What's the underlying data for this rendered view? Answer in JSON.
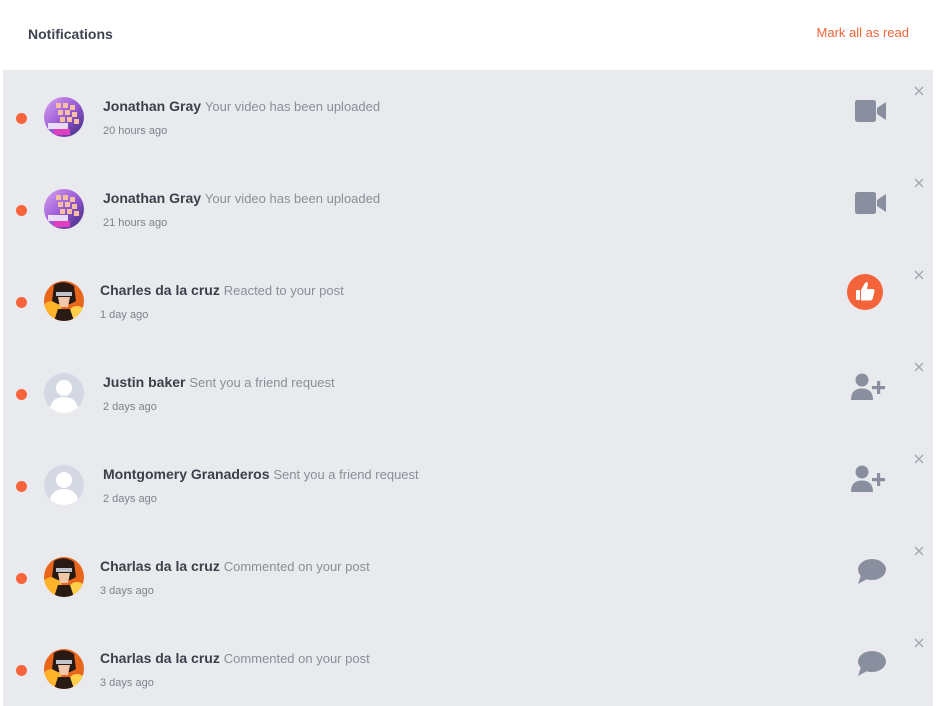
{
  "header": {
    "title": "Notifications",
    "mark_all_label": "Mark all as read"
  },
  "colors": {
    "accent": "#f06437",
    "unread_dot": "#f7643c",
    "icon_gray": "#8a8fa0",
    "panel_bg": "#e9eaee"
  },
  "notifications": [
    {
      "name": "Jonathan Gray",
      "action": "Your video has been uploaded",
      "time": "20 hours ago",
      "avatar": "keyboard-photo",
      "type_icon": "video-camera-icon",
      "unread": true
    },
    {
      "name": "Jonathan Gray",
      "action": "Your video has been uploaded",
      "time": "21 hours ago",
      "avatar": "keyboard-photo",
      "type_icon": "video-camera-icon",
      "unread": true
    },
    {
      "name": "Charles da la cruz",
      "action": "Reacted to your post",
      "time": "1 day ago",
      "avatar": "anime-character-photo",
      "type_icon": "thumbs-up-icon",
      "unread": true
    },
    {
      "name": "Justin baker",
      "action": "Sent you a friend request",
      "time": "2 days ago",
      "avatar": "default-user-silhouette",
      "type_icon": "add-user-icon",
      "unread": true
    },
    {
      "name": "Montgomery Granaderos",
      "action": "Sent you a friend request",
      "time": "2 days ago",
      "avatar": "default-user-silhouette",
      "type_icon": "add-user-icon",
      "unread": true
    },
    {
      "name": "Charlas da la cruz",
      "action": "Commented on your post",
      "time": "3 days ago",
      "avatar": "anime-character-photo",
      "type_icon": "speech-bubble-icon",
      "unread": true
    },
    {
      "name": "Charlas da la cruz",
      "action": "Commented on your post",
      "time": "3 days ago",
      "avatar": "anime-character-photo",
      "type_icon": "speech-bubble-icon",
      "unread": true
    }
  ]
}
